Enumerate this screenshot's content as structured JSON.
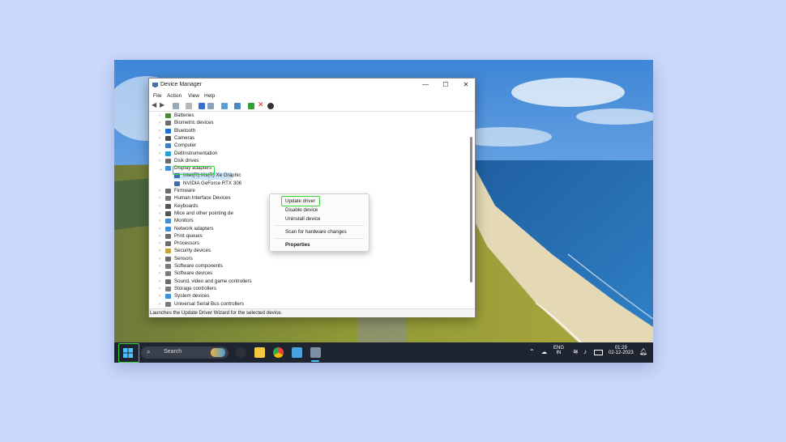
{
  "window": {
    "title": "Device Manager",
    "minimize": "—",
    "maximize": "☐",
    "close": "✕"
  },
  "menu": [
    "File",
    "Action",
    "View",
    "Help"
  ],
  "tree": {
    "categories": [
      "Batteries",
      "Biometric devices",
      "Bluetooth",
      "Cameras",
      "Computer",
      "DellInstrumentation",
      "Disk drives",
      "Display adapters",
      "Firmware",
      "Human Interface Devices",
      "Keyboards",
      "Mice and other pointing de",
      "Monitors",
      "Network adapters",
      "Print queues",
      "Processors",
      "Security devices",
      "Sensors",
      "Software components",
      "Software devices",
      "Sound, video and game controllers",
      "Storage controllers",
      "System devices",
      "Universal Serial Bus controllers"
    ],
    "display_children": [
      "Intel(R) Iris(R) Xe Graphic",
      "NVIDIA GeForce RTX 306"
    ]
  },
  "context_menu": {
    "update": "Update driver",
    "disable": "Disable device",
    "uninstall": "Uninstall device",
    "scan": "Scan for hardware changes",
    "properties": "Properties"
  },
  "status_text": "Launches the Update Driver Wizard for the selected device.",
  "taskbar": {
    "search_placeholder": "Search",
    "lang_1": "ENG",
    "lang_2": "IN",
    "time": "01:29",
    "date": "02-12-2023"
  },
  "colors": {
    "highlight": "#37d43b",
    "taskbar": "#1f2530",
    "page_bg": "#c9d8fb"
  }
}
